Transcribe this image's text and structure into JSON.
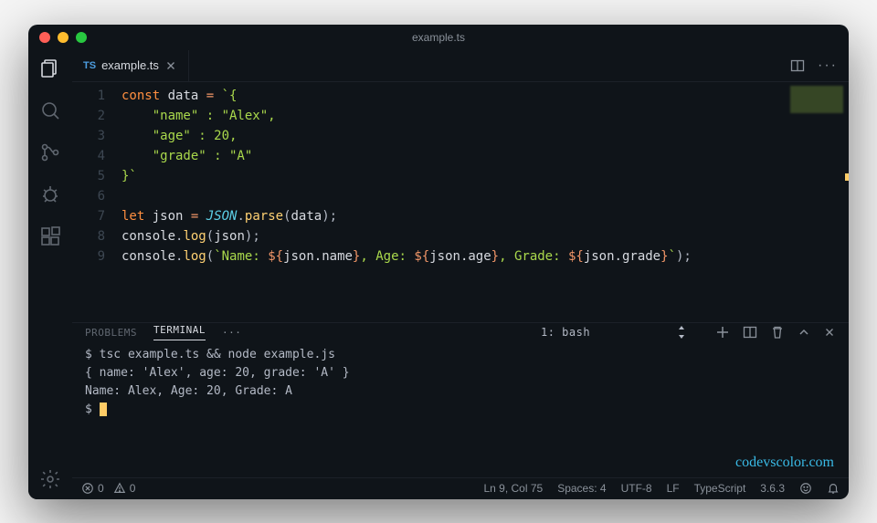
{
  "window": {
    "title": "example.ts"
  },
  "tab": {
    "lang_badge": "TS",
    "filename": "example.ts"
  },
  "code": {
    "lines": [
      {
        "n": "1"
      },
      {
        "n": "2"
      },
      {
        "n": "3"
      },
      {
        "n": "4"
      },
      {
        "n": "5"
      },
      {
        "n": "6"
      },
      {
        "n": "7"
      },
      {
        "n": "8"
      },
      {
        "n": "9"
      }
    ],
    "l1_kw": "const",
    "l1_var": "data",
    "l1_eq": " = ",
    "l1_tick": "`{",
    "l2": "    \"name\" : \"Alex\",",
    "l3": "    \"age\" : 20,",
    "l4": "    \"grade\" : \"A\"",
    "l5": "}`",
    "l7_kw": "let",
    "l7_var": "json",
    "l7_eq": " = ",
    "l7_obj": "JSON",
    "l7_dot": ".",
    "l7_fn": "parse",
    "l7_open": "(",
    "l7_arg": "data",
    "l7_close": ");",
    "l8_obj": "console",
    "l8_dot": ".",
    "l8_fn": "log",
    "l8_open": "(",
    "l8_arg": "json",
    "l8_close": ");",
    "l9_obj": "console",
    "l9_dot": ".",
    "l9_fn": "log",
    "l9_open": "(",
    "l9_s1": "`Name: ",
    "l9_i1o": "${",
    "l9_i1v": "json.name",
    "l9_i1c": "}",
    "l9_s2": ", Age: ",
    "l9_i2o": "${",
    "l9_i2v": "json.age",
    "l9_i2c": "}",
    "l9_s3": ", Grade: ",
    "l9_i3o": "${",
    "l9_i3v": "json.grade",
    "l9_i3c": "}",
    "l9_s4": "`",
    "l9_close": ");"
  },
  "panel": {
    "tabs": {
      "problems": "PROBLEMS",
      "terminal": "TERMINAL"
    },
    "dots": "···",
    "selector": "1: bash",
    "term_line1": "$ tsc example.ts && node example.js",
    "term_line2": "{ name: 'Alex', age: 20, grade: 'A' }",
    "term_line3": "Name: Alex, Age: 20, Grade: A",
    "term_prompt": "$ "
  },
  "watermark": "codevscolor.com",
  "status": {
    "errors": "0",
    "warnings": "0",
    "lncol": "Ln 9, Col 75",
    "spaces": "Spaces: 4",
    "encoding": "UTF-8",
    "eol": "LF",
    "language": "TypeScript",
    "version": "3.6.3"
  }
}
